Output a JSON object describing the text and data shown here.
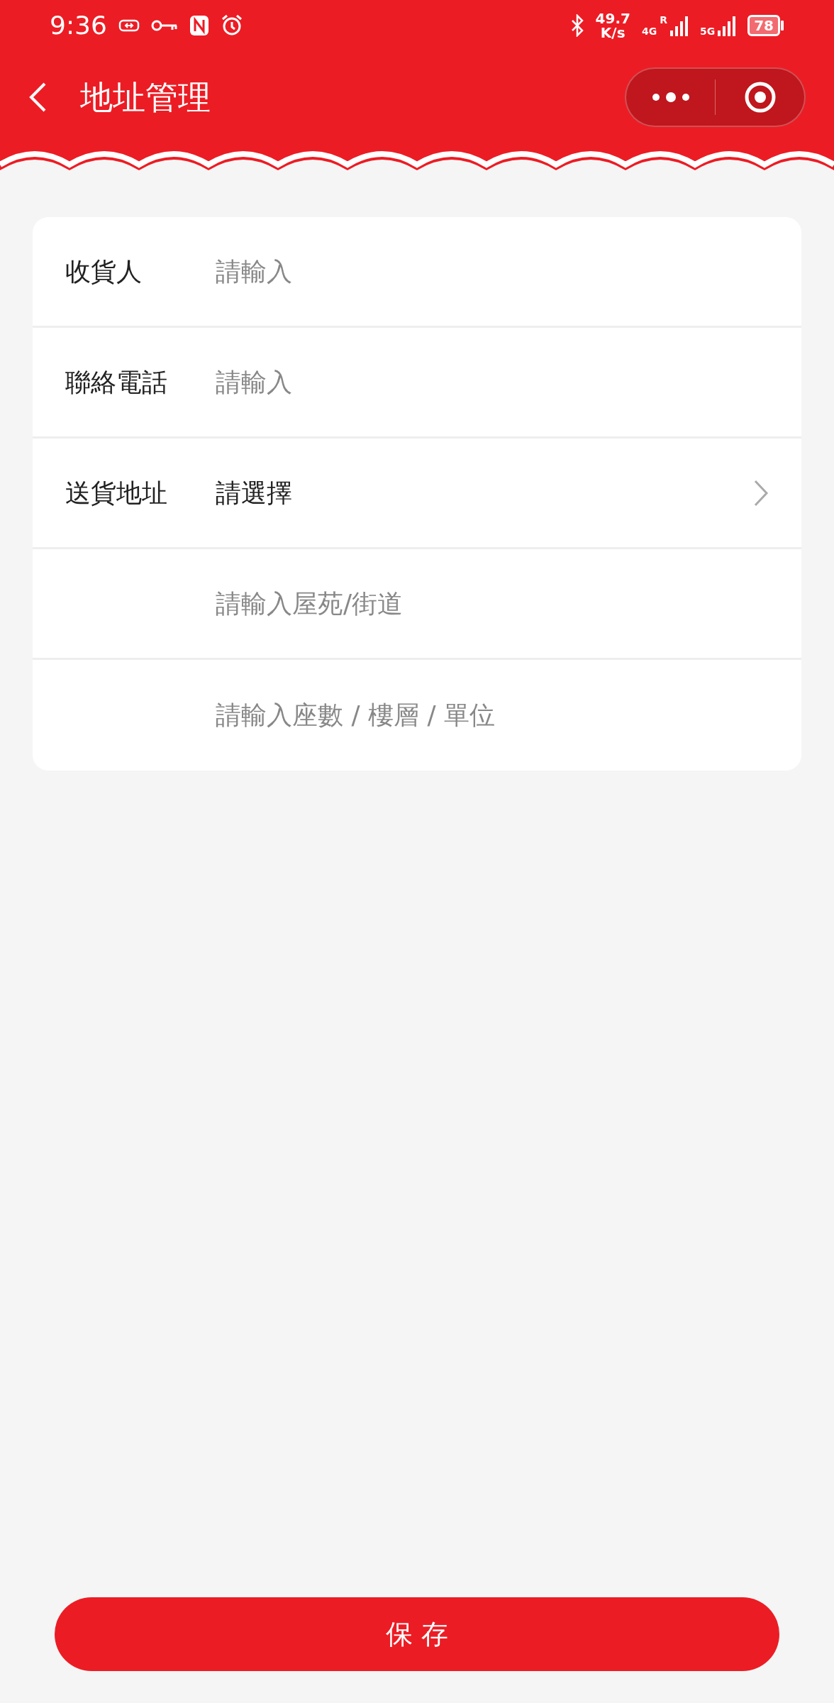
{
  "status_bar": {
    "time": "9:36",
    "speed": "49.7",
    "speed_unit": "K/s",
    "network_1": "4G",
    "network_1_roaming": "R",
    "network_2": "5G",
    "battery": "78"
  },
  "header": {
    "title": "地址管理"
  },
  "form": {
    "fields": [
      {
        "kind": "input",
        "label": "收貨人",
        "placeholder": "請輸入"
      },
      {
        "kind": "input",
        "label": "聯絡電話",
        "placeholder": "請輸入"
      },
      {
        "kind": "select",
        "label": "送貨地址",
        "value": "請選擇"
      },
      {
        "kind": "input",
        "placeholder": "請輸入屋苑/街道"
      },
      {
        "kind": "input",
        "placeholder": "請輸入座數 / 樓層 / 單位"
      }
    ]
  },
  "save_button": "保 存"
}
